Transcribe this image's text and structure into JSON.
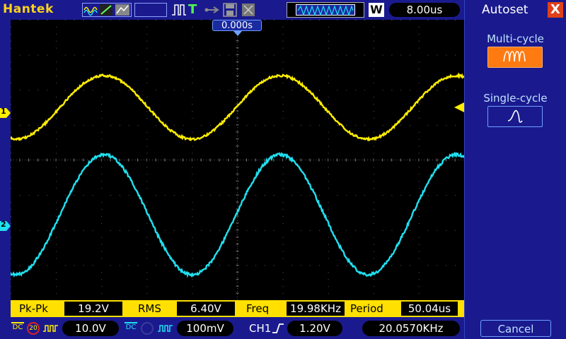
{
  "app": {
    "brand": "Hantek"
  },
  "toolbar": {
    "timebase": "8.00us",
    "w_button": "W",
    "trigger_icon": "T"
  },
  "screen": {
    "trigger_time": "0.000s",
    "ch1_marker": "1",
    "ch2_marker": "2",
    "ch1_color": "#ffee00",
    "ch2_color": "#20e0f0"
  },
  "measurements": {
    "pkpk_label": "Pk-Pk",
    "pkpk_value": "19.2V",
    "rms_label": "RMS",
    "rms_value": "6.40V",
    "freq_label": "Freq",
    "freq_value": "19.98KHz",
    "period_label": "Period",
    "period_value": "50.04us"
  },
  "status": {
    "ch1_coupling": "DC",
    "ch1_bwlimit": "20",
    "ch1_scale": "10.0V",
    "ch2_coupling": "DC",
    "ch2_scale": "100mV",
    "trigger_source": "CH1",
    "trigger_level": "1.20V",
    "trigger_freq": "20.0570KHz"
  },
  "panel": {
    "title": "Autoset",
    "close": "X",
    "multi_cycle": "Multi-cycle",
    "single_cycle": "Single-cycle",
    "cancel": "Cancel"
  }
}
